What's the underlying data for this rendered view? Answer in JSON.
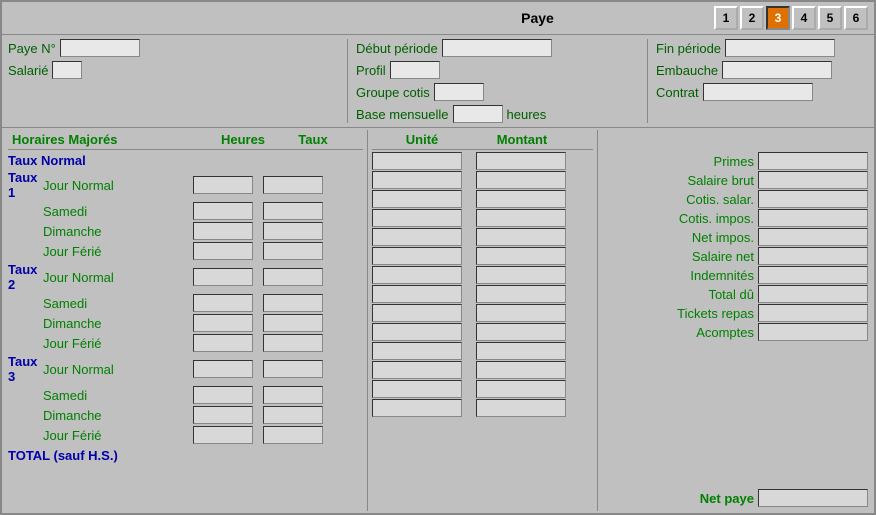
{
  "title": "Paye",
  "tabs": [
    {
      "label": "1",
      "active": false
    },
    {
      "label": "2",
      "active": false
    },
    {
      "label": "3",
      "active": true
    },
    {
      "label": "4",
      "active": false
    },
    {
      "label": "5",
      "active": false
    },
    {
      "label": "6",
      "active": false
    }
  ],
  "left_info": {
    "paye_n_label": "Paye N°",
    "salarie_label": "Salarié"
  },
  "middle_info": {
    "debut_periode_label": "Début période",
    "profil_label": "Profil",
    "groupe_cotis_label": "Groupe cotis",
    "base_mensuelle_label": "Base mensuelle",
    "heures_label": "heures"
  },
  "right_info": {
    "fin_periode_label": "Fin période",
    "embauche_label": "Embauche",
    "contrat_label": "Contrat"
  },
  "table_headers": {
    "horaires_majores": "Horaires Majorés",
    "heures": "Heures",
    "taux": "Taux",
    "unite": "Unité",
    "montant": "Montant"
  },
  "taux_normal_label": "Taux Normal",
  "taux_sections": [
    {
      "num": "Taux 1",
      "rows": [
        "Jour Normal",
        "Samedi",
        "Dimanche",
        "Jour Férié"
      ]
    },
    {
      "num": "Taux 2",
      "rows": [
        "Jour Normal",
        "Samedi",
        "Dimanche",
        "Jour Férié"
      ]
    },
    {
      "num": "Taux 3",
      "rows": [
        "Jour Normal",
        "Samedi",
        "Dimanche",
        "Jour Férié"
      ]
    }
  ],
  "total_label": "TOTAL (sauf H.S.)",
  "right_labels": [
    "Primes",
    "Salaire brut",
    "Cotis. salar.",
    "Cotis. impos.",
    "Net impos.",
    "Salaire net",
    "Indemnités",
    "Total dû",
    "Tickets repas",
    "Acomptes"
  ],
  "net_paye_label": "Net paye"
}
